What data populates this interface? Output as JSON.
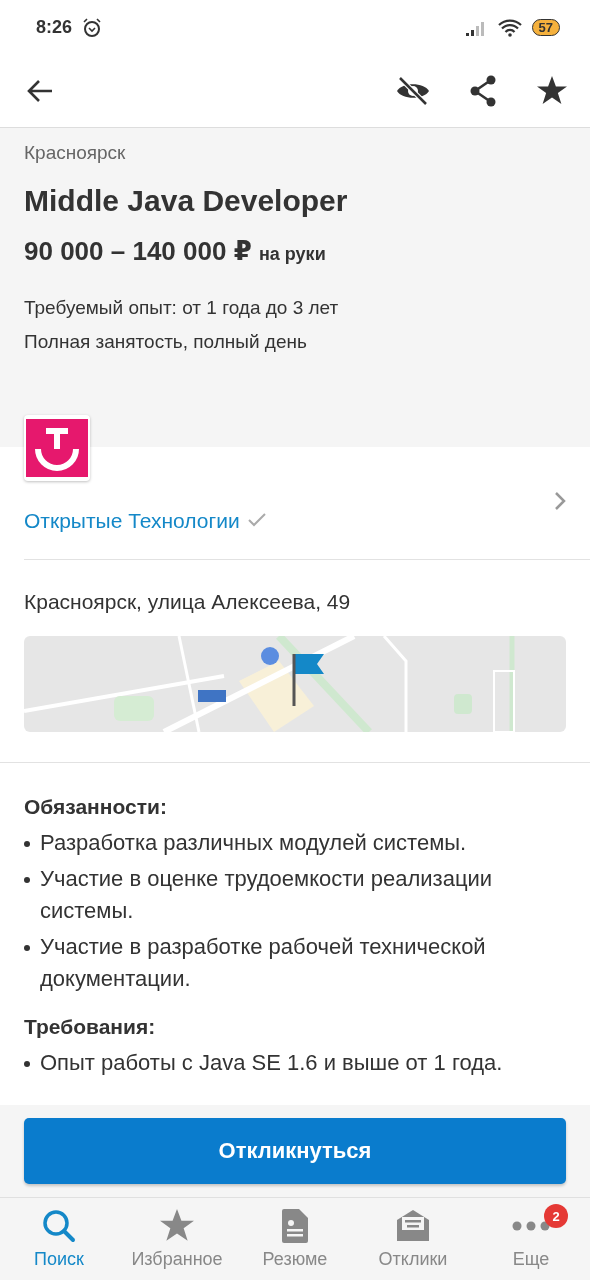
{
  "status_bar": {
    "time": "8:26",
    "battery": "57"
  },
  "header": {
    "city": "Красноярск",
    "title": "Middle Java Developer",
    "salary": "90 000 – 140 000 ₽",
    "salary_note": "на руки",
    "experience": "Требуемый опыт: от 1 года до 3 лет",
    "employment": "Полная занятость, полный день"
  },
  "company": {
    "name": "Открытые Технологии",
    "verified": true
  },
  "address": "Красноярск, улица Алексеева, 49",
  "sections": [
    {
      "title": "Обязанности:",
      "items": [
        "Разработка различных модулей системы.",
        "Участие в оценке трудоемкости реализации системы.",
        "Участие в разработке рабочей технической документации."
      ]
    },
    {
      "title": "Требования:",
      "items": [
        "Опыт работы с Java SE 1.6 и выше от 1 года."
      ]
    }
  ],
  "apply_button": "Откликнуться",
  "nav": [
    {
      "label": "Поиск",
      "kind": "search",
      "selected": true
    },
    {
      "label": "Избранное",
      "kind": "star",
      "selected": false
    },
    {
      "label": "Резюме",
      "kind": "doc",
      "selected": false
    },
    {
      "label": "Отклики",
      "kind": "mail",
      "selected": false
    },
    {
      "label": "Еще",
      "kind": "more",
      "selected": false,
      "badge": "2"
    }
  ]
}
